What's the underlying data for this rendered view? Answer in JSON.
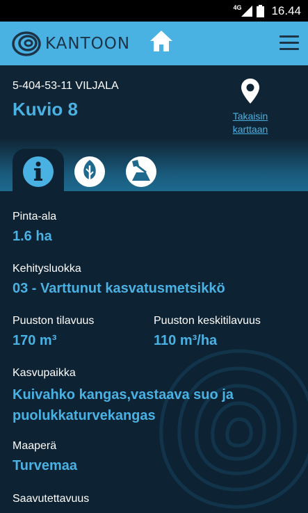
{
  "status_bar": {
    "network": "4G",
    "time": "16.44"
  },
  "app": {
    "brand": "KANTOON"
  },
  "header": {
    "parcel_id": "5-404-53-11 VILJALA",
    "figure_title": "Kuvio 8",
    "back_link_line1": "Takaisin",
    "back_link_line2": "karttaan"
  },
  "tabs": [
    {
      "name": "info",
      "icon": "info-icon",
      "active": true
    },
    {
      "name": "tree",
      "icon": "tree-icon",
      "active": false
    },
    {
      "name": "harvest",
      "icon": "axe-stump-icon",
      "active": false
    }
  ],
  "details": {
    "area_label": "Pinta-ala",
    "area_value": "1.6 ha",
    "dev_class_label": "Kehitysluokka",
    "dev_class_value": "03 - Varttunut kasvatusmetsikkö",
    "volume_label": "Puuston tilavuus",
    "volume_value": "170 m³",
    "avg_volume_label": "Puuston keskitilavuus",
    "avg_volume_value": "110 m³/ha",
    "site_label": "Kasvupaikka",
    "site_value": "Kuivahko kangas,vastaava suo ja puolukkaturvekangas",
    "soil_label": "Maaperä",
    "soil_value": "Turvemaa",
    "access_label": "Saavutettavuus"
  },
  "colors": {
    "accent": "#4ab1e3",
    "background": "#0d2233",
    "brand_dark": "#1d3447"
  }
}
